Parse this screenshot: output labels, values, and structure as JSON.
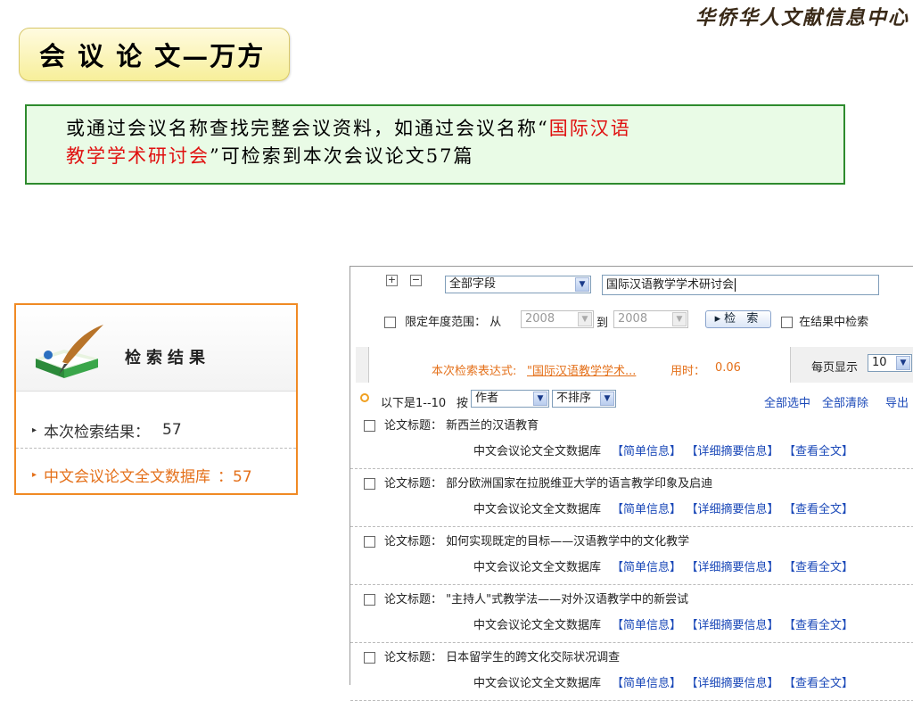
{
  "header": {
    "logo_text": "华侨华人文献信息中心"
  },
  "title": "会 议 论 文—万方",
  "info": {
    "part1": "或通过会议名称查找完整会议资料，如通过会议名称“",
    "highlight1": "国际汉语",
    "highlight2": "教学学术研讨会",
    "part2": "”可检索到本次会议论文57篇"
  },
  "left_panel": {
    "title": "检索结果",
    "row1_label": "本次检索结果：",
    "row1_count": "57",
    "row2_label": "中文会议论文全文数据库",
    "row2_count": "：57"
  },
  "search": {
    "plus": "+",
    "minus": "−",
    "field_select": "全部字段",
    "query": "国际汉语教学学术研讨会",
    "year_label": "限定年度范围： 从",
    "year_from": "2008",
    "to_label": "到",
    "year_to": "2008",
    "search_button": "▸检 索",
    "in_results": "在结果中检索"
  },
  "expression": {
    "label": "本次检索表达式:",
    "value": "\"国际汉语教学学术...",
    "time_label": "用时：",
    "time_value": "0.06",
    "per_page_label": "每页显示",
    "per_page_value": "10"
  },
  "toolbar": {
    "range_text": "以下是1--10",
    "sort_by": "按",
    "sort_field": "作者",
    "sort_order": "不排序",
    "select_all": "全部选中",
    "clear_all": "全部清除",
    "export": "导出"
  },
  "results": {
    "title_label": "论文标题：",
    "source": "中文会议论文全文数据库",
    "link_brief": "【简单信息】",
    "link_detail": "【详细摘要信息】",
    "link_full": "【查看全文】",
    "items": [
      "新西兰的汉语教育",
      "部分欧洲国家在拉脱维亚大学的语言教学印象及启迪",
      "如何实现既定的目标——汉语教学中的文化教学",
      "\"主持人\"式教学法——对外汉语教学中的新尝试",
      "日本留学生的跨文化交际状况调查"
    ]
  }
}
